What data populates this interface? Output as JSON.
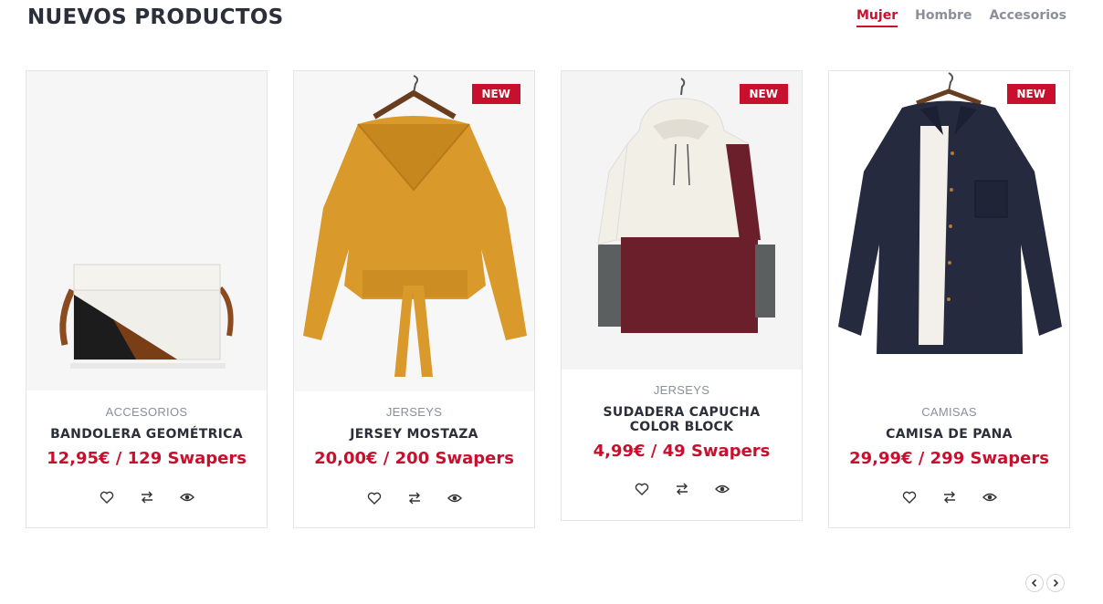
{
  "section": {
    "title": "NUEVOS PRODUCTOS"
  },
  "tabs": [
    {
      "label": "Mujer",
      "active": true
    },
    {
      "label": "Hombre",
      "active": false
    },
    {
      "label": "Accesorios",
      "active": false
    }
  ],
  "products": [
    {
      "category": "ACCESORIOS",
      "name": "BANDOLERA GEOMÉTRICA",
      "price": "12,95€ / 129 Swapers",
      "badge": "",
      "image_icon": "bag-image"
    },
    {
      "category": "JERSEYS",
      "name": "JERSEY MOSTAZA",
      "price": "20,00€ / 200 Swapers",
      "badge": "NEW",
      "image_icon": "sweater-image"
    },
    {
      "category": "JERSEYS",
      "name": "SUDADERA CAPUCHA COLOR BLOCK",
      "price": "4,99€ / 49 Swapers",
      "badge": "NEW",
      "image_icon": "hoodie-image"
    },
    {
      "category": "CAMISAS",
      "name": "CAMISA DE PANA",
      "price": "29,99€ / 299 Swapers",
      "badge": "NEW",
      "image_icon": "shirt-image"
    }
  ],
  "actions": [
    "heart-icon",
    "compare-icon",
    "eye-icon"
  ],
  "colors": {
    "accent": "#c8102e",
    "title": "#2b2f3a",
    "muted": "#8a8f99"
  }
}
